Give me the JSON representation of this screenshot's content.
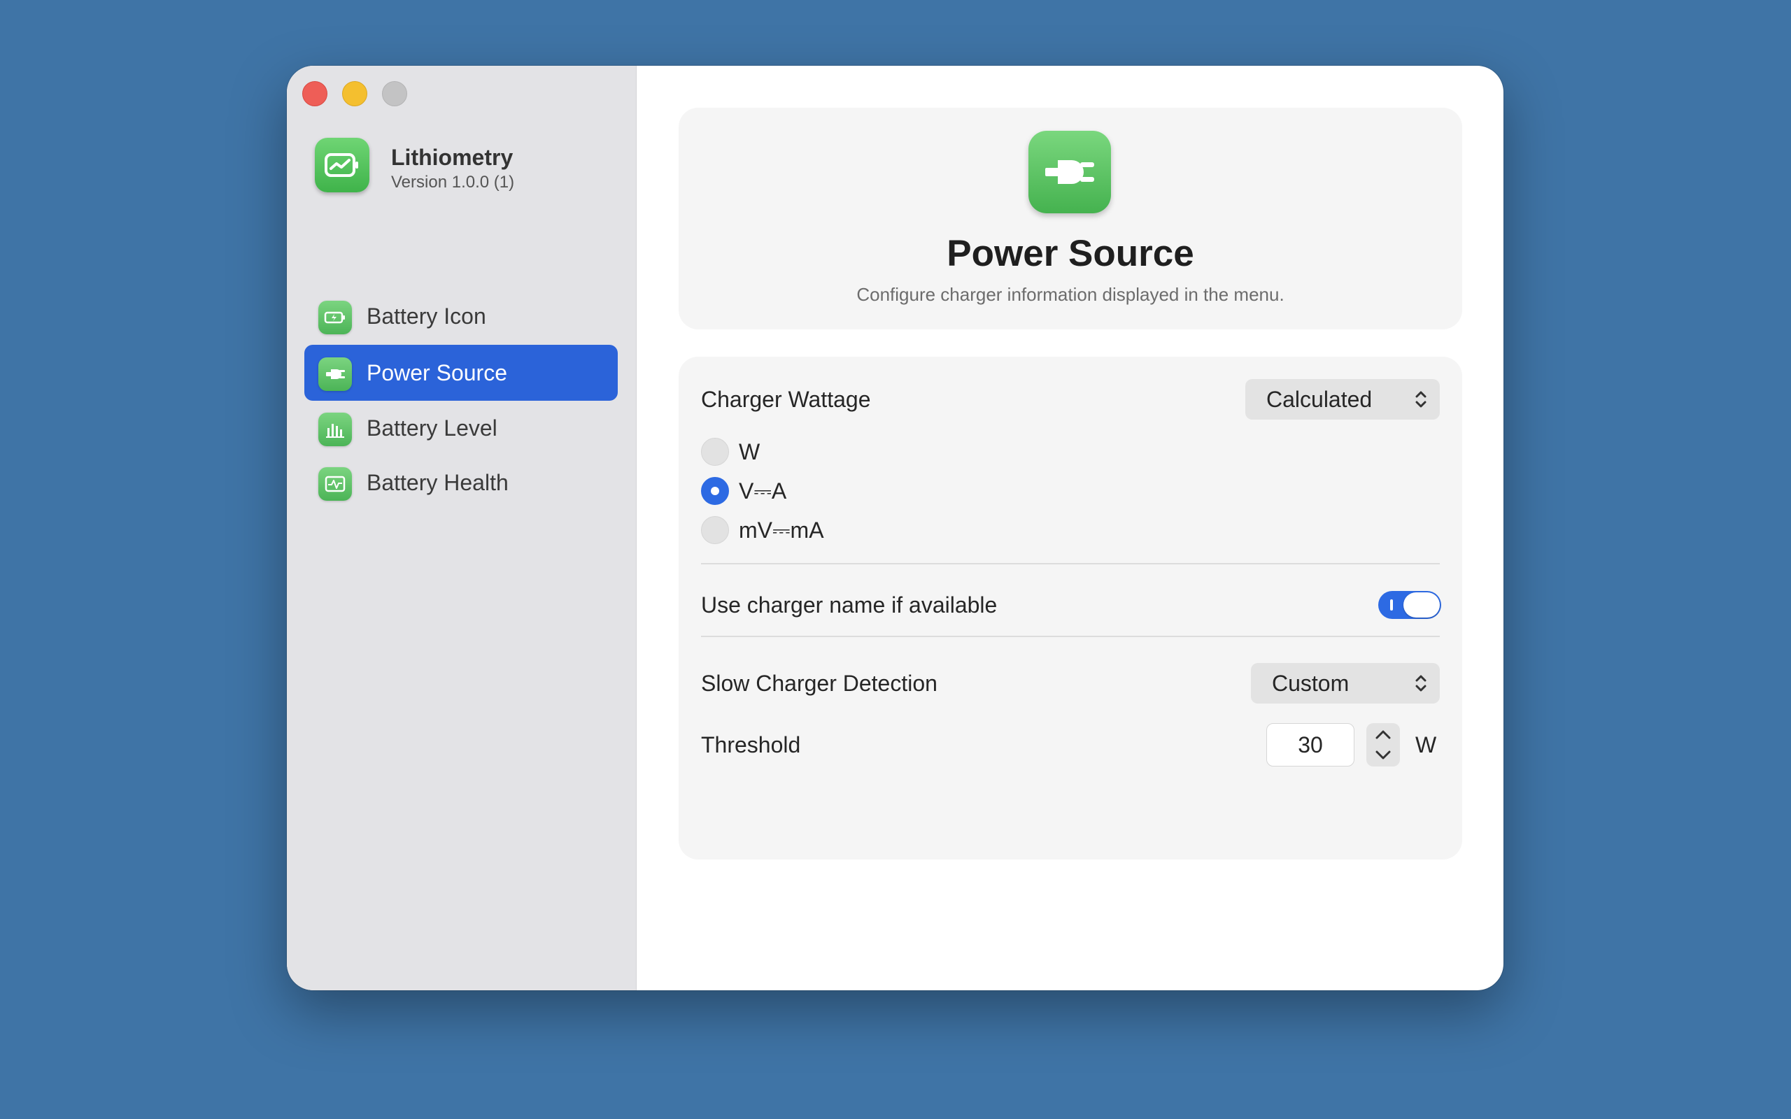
{
  "app": {
    "name": "Lithiometry",
    "version": "Version 1.0.0 (1)"
  },
  "sidebar": {
    "items": [
      {
        "label": "Battery Icon",
        "icon": "battery-icon"
      },
      {
        "label": "Power Source",
        "icon": "plug-icon",
        "selected": true
      },
      {
        "label": "Battery Level",
        "icon": "bar-chart-icon"
      },
      {
        "label": "Battery Health",
        "icon": "pulse-icon"
      }
    ]
  },
  "header": {
    "title": "Power Source",
    "subtitle": "Configure charger information displayed in the menu."
  },
  "settings": {
    "charger_wattage": {
      "label": "Charger Wattage",
      "value": "Calculated",
      "options": [
        "W",
        "V⎓A",
        "mV⎓mA"
      ],
      "selected_option": "V⎓A"
    },
    "charger_name": {
      "label": "Use charger name if available",
      "enabled": true
    },
    "slow_charger": {
      "label": "Slow Charger Detection",
      "value": "Custom"
    },
    "threshold": {
      "label": "Threshold",
      "value": "30",
      "unit": "W"
    }
  },
  "colors": {
    "accent": "#2d6ae3",
    "sidebar_selected": "#2b63d9",
    "icon_green": "#4cb457",
    "desktop": "#3f74a6"
  }
}
